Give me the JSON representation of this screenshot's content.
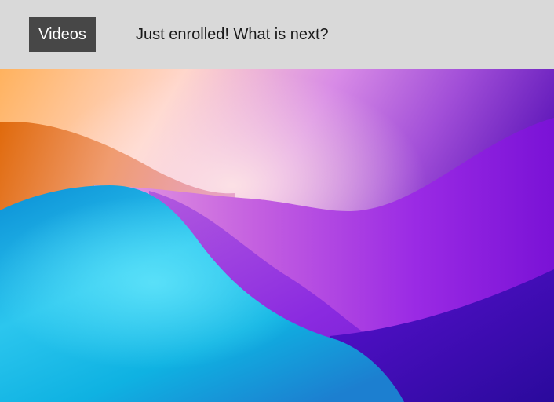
{
  "header": {
    "videos_button_label": "Videos",
    "headline": "Just enrolled! What is next?"
  },
  "media": {
    "wallpaper_icon": "abstract-wave-wallpaper",
    "colors": {
      "orange": "#e8740e",
      "peach": "#ffd8c7",
      "pink": "#e99de0",
      "purple": "#8d1fe0",
      "indigo": "#4309c4",
      "cyan": "#34d3f2",
      "blue": "#0e85d6"
    }
  }
}
